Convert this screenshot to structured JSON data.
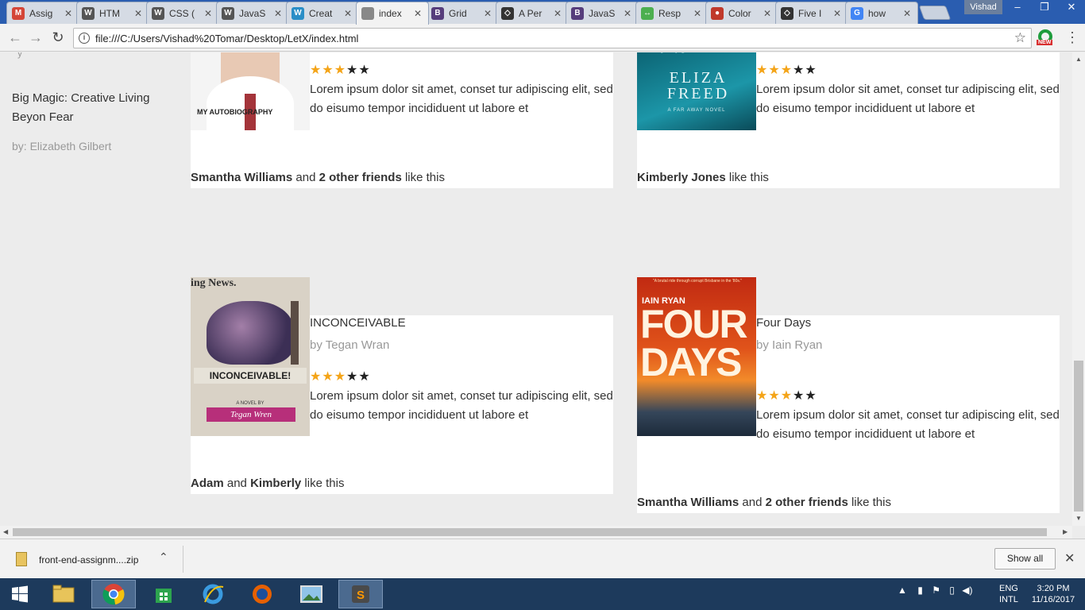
{
  "browser": {
    "tabs": [
      {
        "label": "Assig",
        "icon": "gmail-icon",
        "color": "#d44638"
      },
      {
        "label": "HTM",
        "icon": "wordpress-icon",
        "color": "#555555"
      },
      {
        "label": "CSS (",
        "icon": "wordpress-icon",
        "color": "#555555"
      },
      {
        "label": "JavaS",
        "icon": "wordpress-icon",
        "color": "#555555"
      },
      {
        "label": "Creat",
        "icon": "wordpress-icon",
        "color": "#2a8ec7"
      },
      {
        "label": "index",
        "icon": "document-icon",
        "color": "#888888"
      },
      {
        "label": "Grid",
        "icon": "bootstrap-icon",
        "color": "#563d7c"
      },
      {
        "label": "A Per",
        "icon": "codepen-icon",
        "color": "#333333"
      },
      {
        "label": "JavaS",
        "icon": "bootstrap-icon",
        "color": "#563d7c"
      },
      {
        "label": "Resp",
        "icon": "responsive-icon",
        "color": "#4caf50"
      },
      {
        "label": "Color",
        "icon": "color-icon",
        "color": "#c0392b"
      },
      {
        "label": "Five I",
        "icon": "codepen-icon",
        "color": "#333333"
      },
      {
        "label": "how",
        "icon": "google-icon",
        "color": "#4285f4"
      }
    ],
    "active_tab_index": 5,
    "user": "Vishad",
    "url": "file:///C:/Users/Vishad%20Tomar/Desktop/LetX/index.html",
    "ext_badge": "NEW"
  },
  "sidebar": {
    "stub_text": "y",
    "book_title": "Big Magic: Creative Living Beyon Fear",
    "book_author": "by: Elizabeth Gilbert"
  },
  "cards": [
    {
      "cover_text": "MY AUTOBIOGRAPHY",
      "rating": 3,
      "desc": "Lorem ipsum dolor sit amet, conset tur adipiscing elit, sed do eisumo tempor incididuent ut labore et",
      "likes": [
        {
          "bold": "Smantha Williams"
        },
        {
          "plain": " and "
        },
        {
          "bold": "2 other friends"
        },
        {
          "plain": " like this"
        }
      ]
    },
    {
      "cover_text_top": "playground",
      "cover_text": "ELIZA FREED",
      "cover_sub": "A FAR AWAY NOVEL",
      "rating": 3,
      "desc": "Lorem ipsum dolor sit amet, conset tur adipiscing elit, sed do eisumo tempor incididuent ut labore et",
      "likes": [
        {
          "bold": "Kimberly Jones"
        },
        {
          "plain": " like this"
        }
      ]
    },
    {
      "title": "INCONCEIVABLE",
      "author": "by Tegan Wran",
      "cover_text": "INCONCEIVABLE!",
      "cover_sub": "Tegan Wren",
      "cover_kicker": "A NOVEL BY",
      "cover_top": "ing News.",
      "rating": 3,
      "desc": "Lorem ipsum dolor sit amet, conset tur adipiscing elit, sed do eisumo tempor incididuent ut labore et",
      "likes": [
        {
          "bold": "Adam"
        },
        {
          "plain": " and "
        },
        {
          "bold": "Kimberly"
        },
        {
          "plain": " like this"
        }
      ]
    },
    {
      "title": "Four Days",
      "author": "by Iain Ryan",
      "cover_author": "IAIN RYAN",
      "cover_text_1": "FOUR",
      "cover_text_2": "DAYS",
      "cover_quote": "\"A brutal ride through corrupt Brisbane in the '80s.\"",
      "rating": 3,
      "desc": "Lorem ipsum dolor sit amet, conset tur adipiscing elit, sed do eisumo tempor incididuent ut labore et",
      "likes": [
        {
          "bold": "Smantha Williams"
        },
        {
          "plain": " and "
        },
        {
          "bold": "2 other friends"
        },
        {
          "plain": " like this"
        }
      ]
    }
  ],
  "rating_max": 5,
  "colors": {
    "star_on": "#f4a418",
    "star_off": "#222222"
  },
  "downloads": {
    "file": "front-end-assignm....zip",
    "show_all": "Show all"
  },
  "taskbar": {
    "lang_1": "ENG",
    "lang_2": "INTL",
    "time": "3:20 PM",
    "date": "11/16/2017"
  }
}
